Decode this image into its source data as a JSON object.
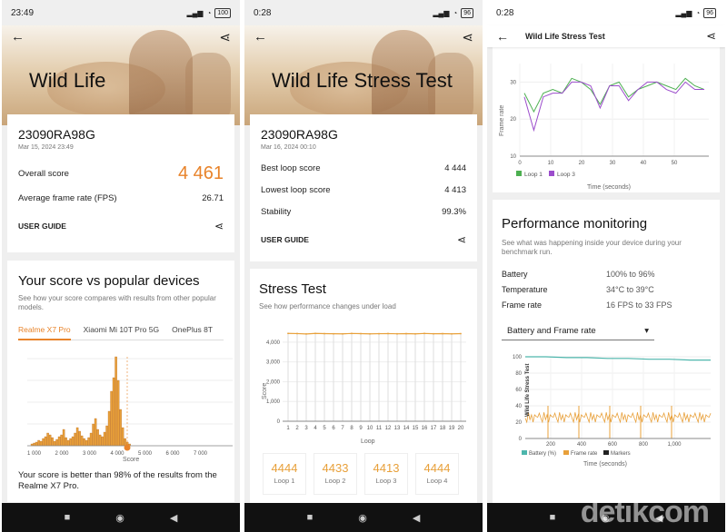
{
  "screen1": {
    "time": "23:49",
    "battery": "100",
    "title": "Wild Life",
    "device": "23090RA98G",
    "date": "Mar 15, 2024 23:49",
    "overall_label": "Overall score",
    "overall_value": "4 461",
    "fps_label": "Average frame rate (FPS)",
    "fps_value": "26.71",
    "guide": "USER GUIDE",
    "compare_title": "Your score vs popular devices",
    "compare_desc": "See how your score compares with results from other popular models.",
    "tabs": [
      "Realme X7 Pro",
      "Xiaomi Mi 10T Pro 5G",
      "OnePlus 8T"
    ],
    "hist_ticks": [
      "1 000",
      "2 000",
      "3 000",
      "4 000",
      "5 000",
      "6 000",
      "7 000"
    ],
    "hist_xlabel": "Score",
    "result_text": "Your score is better than 98% of the results from the Realme X7 Pro."
  },
  "screen2": {
    "time": "0:28",
    "battery": "96",
    "title": "Wild Life Stress Test",
    "device": "23090RA98G",
    "date": "Mar 16, 2024 00:10",
    "best_label": "Best loop score",
    "best_value": "4 444",
    "lowest_label": "Lowest loop score",
    "lowest_value": "4 413",
    "stability_label": "Stability",
    "stability_value": "99.3%",
    "guide": "USER GUIDE",
    "stress_title": "Stress Test",
    "stress_desc": "See how performance changes under load",
    "loops": [
      {
        "value": "4444",
        "label": "Loop 1"
      },
      {
        "value": "4433",
        "label": "Loop 2"
      },
      {
        "value": "4413",
        "label": "Loop 3"
      },
      {
        "value": "4444",
        "label": "Loop 4"
      }
    ]
  },
  "screen3": {
    "time": "0:28",
    "battery": "96",
    "title": "Wild Life Stress Test",
    "pm_title": "Performance monitoring",
    "pm_desc": "See what was happening inside your device during your benchmark run.",
    "battery_label": "Battery",
    "battery_value": "100% to 96%",
    "temp_label": "Temperature",
    "temp_value": "34°C to 39°C",
    "fr_label": "Frame rate",
    "fr_value": "16 FPS to 33 FPS",
    "dropdown": "Battery and Frame rate",
    "legend_battery": "Battery (%)",
    "legend_fr": "Frame rate",
    "legend_markers": "Markers",
    "legend_loop1": "Loop 1",
    "legend_loop3": "Loop 3",
    "time_label": "Time (seconds)",
    "fr_axis": "Frame rate",
    "side_label": "Wild Life Stress Test"
  },
  "watermark": "detikcom",
  "colors": {
    "accent": "#e8832a",
    "loop1": "#4caf50",
    "loop3": "#9c4dcc",
    "battery": "#4db6ac"
  },
  "chart_data": [
    {
      "type": "bar",
      "title": "Your score vs popular devices",
      "xlabel": "Score",
      "categories": [
        "1 000",
        "2 000",
        "3 000",
        "4 000",
        "5 000",
        "6 000",
        "7 000"
      ],
      "values": [
        2,
        5,
        10,
        30,
        1,
        0,
        0
      ]
    },
    {
      "type": "line",
      "title": "Stress Test",
      "ylabel": "Score",
      "xlabel": "Loop",
      "ylim": [
        0,
        4500
      ],
      "x": [
        1,
        2,
        3,
        4,
        5,
        6,
        7,
        8,
        9,
        10,
        11,
        12,
        13,
        14,
        15,
        16,
        17,
        18,
        19,
        20
      ],
      "series": [
        {
          "name": "",
          "values": [
            4444,
            4433,
            4413,
            4444,
            4430,
            4425,
            4420,
            4440,
            4430,
            4418,
            4428,
            4435,
            4422,
            4430,
            4420,
            4440,
            4425,
            4430,
            4418,
            4430
          ]
        }
      ]
    },
    {
      "type": "line",
      "xlabel": "Time (seconds)",
      "ylabel": "Frame rate",
      "ylim": [
        10,
        35
      ],
      "series": [
        {
          "name": "Loop 1",
          "values": [
            27,
            22,
            27,
            28,
            27,
            31,
            30,
            28,
            24,
            29,
            30,
            26,
            28,
            29,
            30,
            29,
            28,
            31,
            29,
            28
          ]
        },
        {
          "name": "Loop 3",
          "values": [
            26,
            17,
            26,
            27,
            27,
            30,
            30,
            29,
            23,
            29,
            29,
            25,
            28,
            30,
            30,
            28,
            27,
            30,
            28,
            28
          ]
        }
      ]
    },
    {
      "type": "line",
      "xlabel": "Time (seconds)",
      "ylim": [
        0,
        100
      ],
      "series": [
        {
          "name": "Battery (%)",
          "values": [
            100,
            100,
            99,
            99,
            98,
            98,
            97,
            97,
            96,
            96
          ]
        },
        {
          "name": "Frame rate",
          "values": [
            27,
            20,
            30,
            24,
            28,
            22,
            29,
            25,
            27,
            30
          ]
        }
      ]
    }
  ]
}
